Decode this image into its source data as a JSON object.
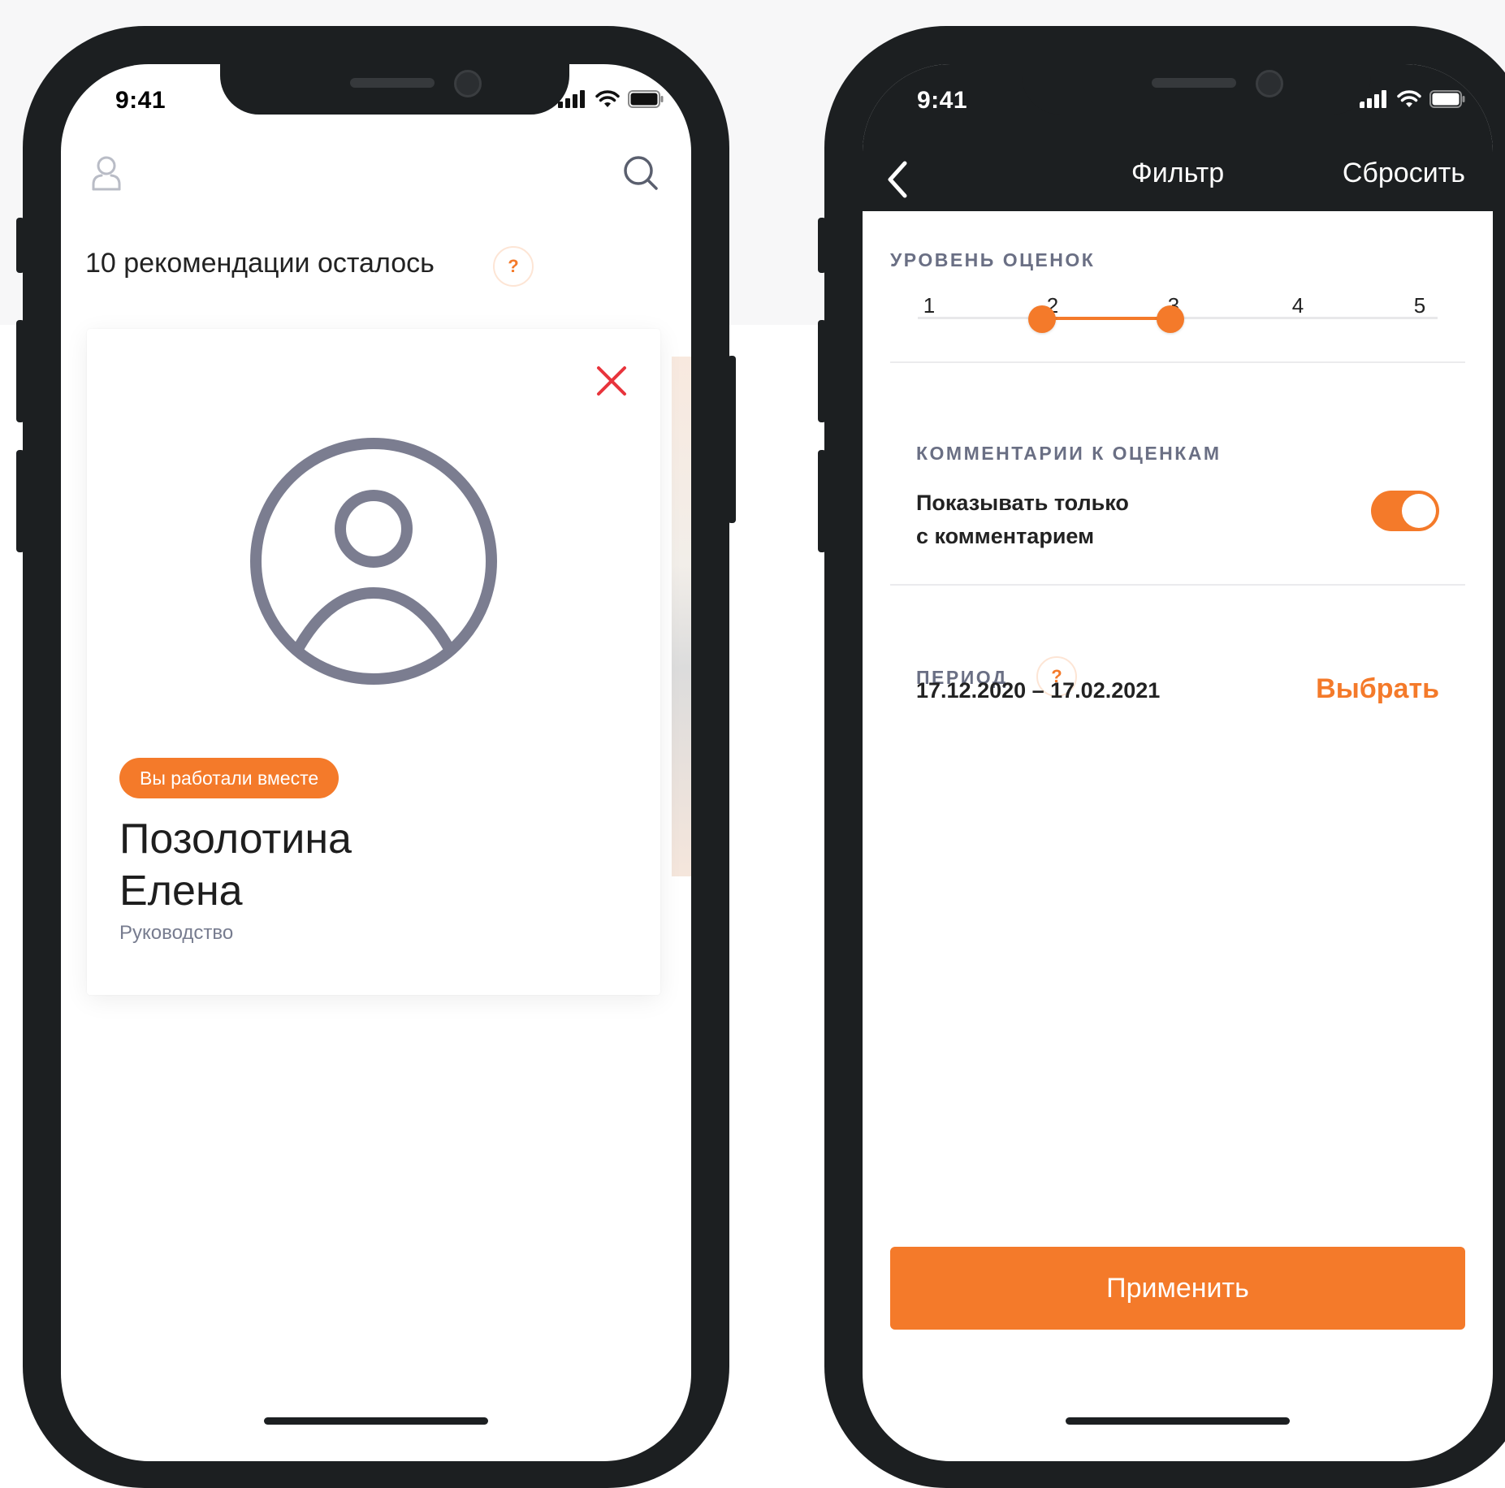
{
  "left_phone": {
    "status": {
      "time": "9:41"
    },
    "recommendations_text": "10 рекомендации осталось",
    "help_mark": "?",
    "card": {
      "tag": "Вы работали вместе",
      "name_line1": "Позолотина",
      "name_line2": "Елена",
      "department": "Руководство"
    }
  },
  "right_phone": {
    "status": {
      "time": "9:41"
    },
    "nav": {
      "title": "Фильтр",
      "reset": "Сбросить"
    },
    "rating_section": {
      "title": "УРОВЕНЬ ОЦЕНОК",
      "scale": [
        "1",
        "2",
        "3",
        "4",
        "5"
      ],
      "selected_min": 2,
      "selected_max": 3
    },
    "comments_section": {
      "title": "КОММЕНТАРИИ К ОЦЕНКАМ",
      "toggle_label_line1": "Показывать только",
      "toggle_label_line2": "с комментарием",
      "toggle_on": true
    },
    "period_section": {
      "title": "ПЕРИОД",
      "help_mark": "?",
      "date_range": "17.12.2020 – 17.02.2021",
      "choose": "Выбрать"
    },
    "apply_button": "Применить"
  },
  "colors": {
    "accent": "#f47a2a",
    "frame": "#1c1f21",
    "close": "#e8343c",
    "muted": "#777c8f"
  }
}
